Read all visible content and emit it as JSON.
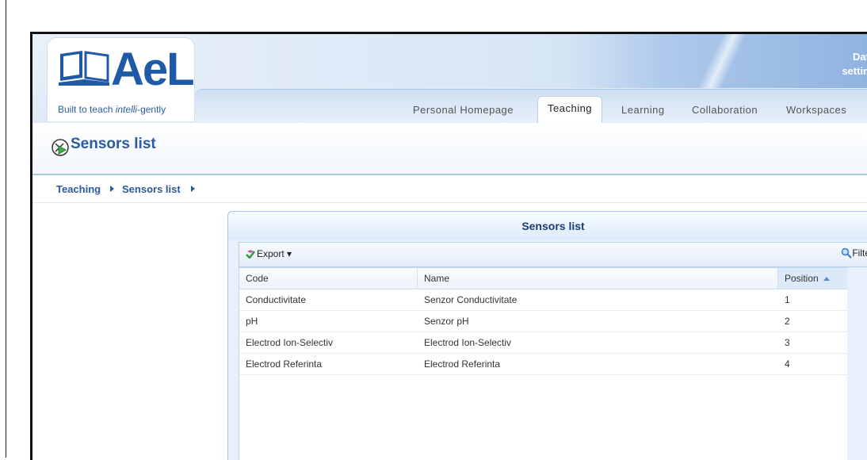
{
  "app": {
    "logo_text": "AeL",
    "tagline_prefix": "Built to teach ",
    "tagline_em": "intelli",
    "tagline_suffix": "-gently",
    "top_right_line1": "Dat",
    "top_right_line2": "settin"
  },
  "tabs": [
    {
      "label": "Personal Homepage",
      "active": false
    },
    {
      "label": "Teaching",
      "active": true
    },
    {
      "label": "Learning",
      "active": false
    },
    {
      "label": "Collaboration",
      "active": false
    },
    {
      "label": "Workspaces",
      "active": false
    }
  ],
  "page": {
    "title": "Sensors list",
    "icon": "sensor-play-icon"
  },
  "breadcrumb": [
    {
      "label": "Teaching"
    },
    {
      "label": "Sensors list"
    }
  ],
  "panel": {
    "title": "Sensors list",
    "export_label": "Export",
    "filter_label": "Filter"
  },
  "table": {
    "columns": [
      "Code",
      "Name",
      "Position"
    ],
    "sorted_column": "Position",
    "rows": [
      {
        "code": "Conductivitate",
        "name": "Senzor Conductivitate",
        "position": "1"
      },
      {
        "code": "pH",
        "name": "Senzor pH",
        "position": "2"
      },
      {
        "code": "Electrod Ion-Selectiv",
        "name": "Electrod Ion-Selectiv",
        "position": "3"
      },
      {
        "code": "Electrod Referinta",
        "name": "Electrod Referinta",
        "position": "4"
      }
    ]
  },
  "colors": {
    "brand": "#1f5aa6",
    "accent": "#2b5aa0",
    "panel_bg": "#e8f1fb"
  }
}
